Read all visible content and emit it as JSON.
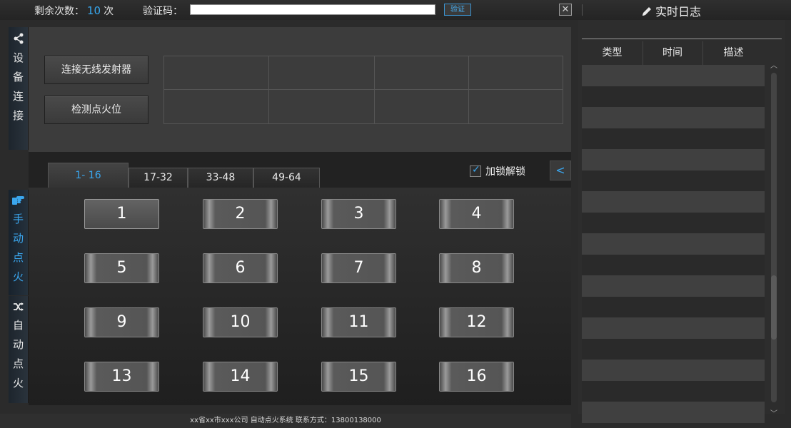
{
  "topbar": {
    "remain_label": "剩余次数：",
    "remain_count": "10",
    "remain_unit": "次",
    "code_label": "验证码：",
    "code_value": "",
    "verify_label": "验证",
    "close_label": "✕",
    "log_title": "实时日志"
  },
  "sidenav": {
    "device": {
      "chars": [
        "设",
        "备",
        "连",
        "接"
      ],
      "icon": "share-icon"
    },
    "manual": {
      "chars": [
        "手",
        "动",
        "点",
        "火"
      ],
      "icon": "hand-icon"
    },
    "auto": {
      "chars": [
        "自",
        "动",
        "点",
        "火"
      ],
      "icon": "shuffle-icon"
    }
  },
  "device_panel": {
    "connect_label": "连接无线发射器",
    "detect_label": "检测点火位"
  },
  "tabs": [
    "1- 16",
    "17-32",
    "33-48",
    "49-64"
  ],
  "active_tab": 0,
  "lock_label": "加锁解锁",
  "lock_checked": true,
  "collapse_label": "<",
  "points": [
    "1",
    "2",
    "3",
    "4",
    "5",
    "6",
    "7",
    "8",
    "9",
    "10",
    "11",
    "12",
    "13",
    "14",
    "15",
    "16"
  ],
  "footer": "xx省xx市xxx公司 自动点火系统 联系方式：13800138000",
  "log": {
    "columns": [
      "类型",
      "时间",
      "描述"
    ],
    "up_arrow": "︿",
    "down_arrow": "﹀"
  },
  "colors": {
    "accent": "#3aa6ee"
  }
}
